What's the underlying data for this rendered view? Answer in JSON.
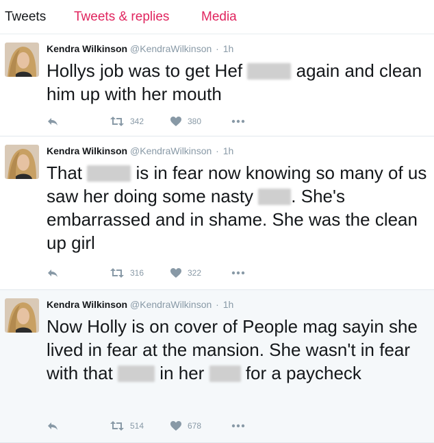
{
  "tabs": [
    "Tweets",
    "Tweets & replies",
    "Media"
  ],
  "author": {
    "name": "Kendra Wilkinson",
    "handle": "@KendraWilkinson",
    "separator": "·"
  },
  "icons": {
    "avatar": "profile-photo",
    "reply": "reply-arrow-icon",
    "retweet": "retweet-icon",
    "like": "heart-icon",
    "more": "more-dots-icon"
  },
  "colors": {
    "accent": "#e0245e",
    "muted": "#8899a6",
    "highlight_bg": "#f5f8fa"
  },
  "tweets": [
    {
      "time": "1h",
      "segments": [
        "Hollys job was to get Hef",
        "again and clean him up with her mouth"
      ],
      "retweets": "342",
      "likes": "380"
    },
    {
      "time": "1h",
      "segments": [
        "That",
        "is in fear now knowing so many of us saw her doing some nasty",
        ". She's embarrassed and in shame. She was the clean up girl"
      ],
      "retweets": "316",
      "likes": "322"
    },
    {
      "time": "1h",
      "segments": [
        "Now Holly is on cover of People mag sayin she lived in fear at the mansion. She wasn't in fear with that",
        "in her",
        "for a paycheck"
      ],
      "retweets": "514",
      "likes": "678"
    }
  ]
}
